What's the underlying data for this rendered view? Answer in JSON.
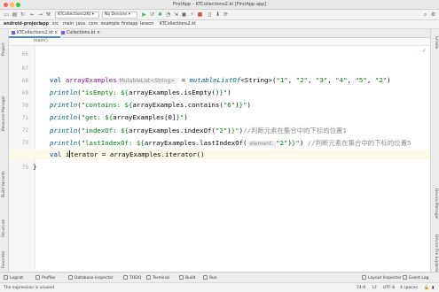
{
  "window": {
    "title": "FirstApp – KTCollections2.kt [FirstApp.app]"
  },
  "toolbar": {
    "run_config": "KTCollections2Kt",
    "device": "No Devices"
  },
  "navbar": {
    "crumbs": [
      "android-project",
      "app",
      "src",
      "main",
      "java",
      "com",
      "example",
      "firstapp",
      "lesson",
      "KTCollections2.kt"
    ]
  },
  "tabs": [
    {
      "label": "KTCollections2.kt",
      "active": true
    },
    {
      "label": "Collections.kt",
      "active": false
    }
  ],
  "breadcrumb": {
    "label": "main()"
  },
  "side_left": [
    "Project",
    "Resource Manager",
    "Structure",
    "Build Variants",
    "Favorites"
  ],
  "side_right": [
    "Gradle",
    "Device Manager",
    "Device File Explorer"
  ],
  "gutter": {
    "lines": [
      "66",
      "67",
      "68",
      "69",
      "70",
      "71",
      "72",
      "73",
      "74",
      "75"
    ]
  },
  "code": {
    "l68": {
      "kw": "val ",
      "var": "arrayExamples",
      "hint": " MutableList<String> ",
      "eq": " = ",
      "fn": "mutableListOf",
      "args_a": "<String>(",
      "s1": "\"1\"",
      "c1": ", ",
      "s2": "\"2\"",
      "c2": ", ",
      "s3": "\"3\"",
      "c3": ", ",
      "s4": "\"4\"",
      "c4": ", ",
      "s5": "\"5\"",
      "c5": ", ",
      "s6": "\"2\"",
      "end": ")"
    },
    "l69": {
      "fn": "println",
      "open": "(",
      "str_a": "\"isEmpty: ${",
      "mid": "arrayExamples.isEmpty()",
      "str_b": "}\"",
      "close": ")"
    },
    "l70": {
      "fn": "println",
      "open": "(",
      "str_a": "\"contains: ${",
      "mid": "arrayExamples.contains(",
      "arg": "\"6\"",
      "mid2": ")",
      "str_b": "}\"",
      "close": ")"
    },
    "l71": {
      "fn": "println",
      "open": "(",
      "str_a": "\"get: ${",
      "mid": "arrayExamples[0]",
      "str_b": "}\"",
      "close": ")"
    },
    "l72": {
      "fn": "println",
      "open": "(",
      "str_a": "\"indexOf: ${",
      "mid": "arrayExamples.indexOf(",
      "arg": "\"2\"",
      "mid2": ")",
      "str_b": "}\"",
      "close": ")",
      "comment": "//判断元素在集合中的下标的位置1"
    },
    "l73": {
      "fn": "println",
      "open": "(",
      "str_a": "\"lastIndexOf: ${",
      "mid": "arrayExamples.lastIndexOf(",
      "hint": " element: ",
      "arg": "\"2\"",
      "mid2": ")",
      "str_b": "}\"",
      "close": ")",
      "comment": " //判断元素在集合中的下标的位置5"
    },
    "l74": {
      "kw": "val ",
      "pre": "i",
      "post": "terator = arrayExamples.iterator()"
    },
    "l75": {
      "text": "}"
    }
  },
  "bottom_tools": [
    "Logcat",
    "Profiler",
    "Database Inspector",
    "TODO",
    "Terminal",
    "Build",
    "Run"
  ],
  "bottom_right": [
    "Layout Inspector",
    "Event Log"
  ],
  "status": {
    "message": "The expression is unused",
    "position": "74:9",
    "line_sep": "LF",
    "encoding": "UTF-8",
    "indent": "4 spaces"
  }
}
